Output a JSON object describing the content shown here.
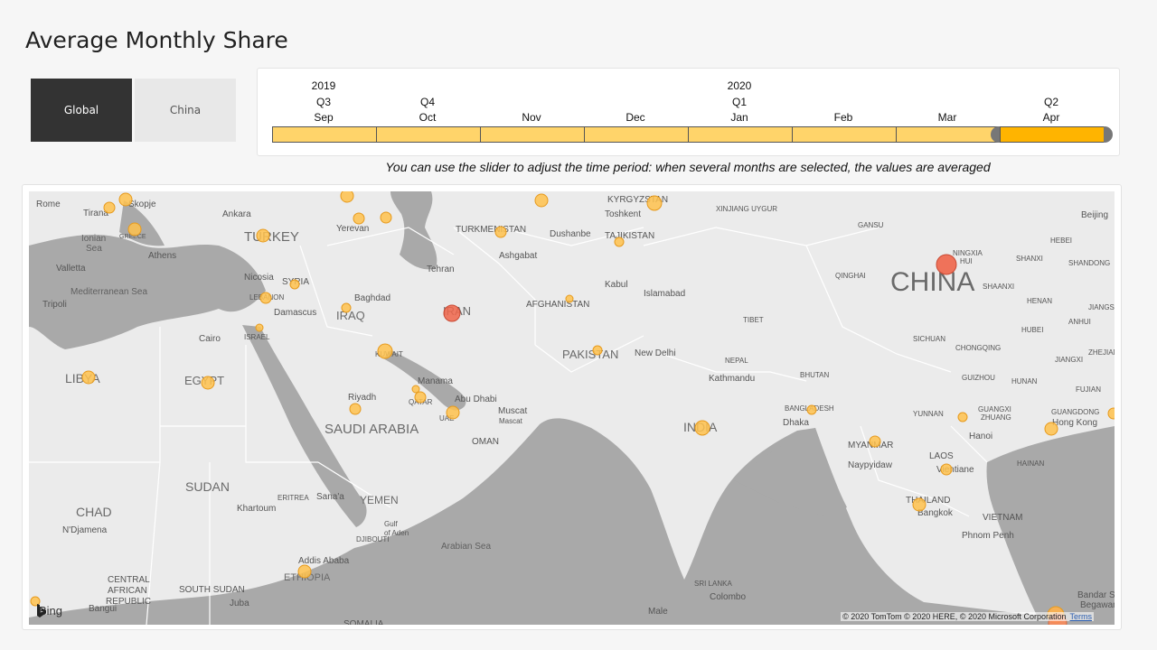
{
  "page": {
    "title": "Average Monthly Share"
  },
  "toggle": {
    "global_label": "Global",
    "china_label": "China",
    "selected": "Global"
  },
  "timeline": {
    "years": [
      "2019",
      "2020"
    ],
    "quarters": [
      "Q3",
      "Q4",
      "Q1",
      "Q2"
    ],
    "months": [
      "Sep",
      "Oct",
      "Nov",
      "Dec",
      "Jan",
      "Feb",
      "Mar",
      "Apr"
    ],
    "selected_month": "Apr",
    "hint": "You can use the slider to adjust the time period: when several months are selected, the values are averaged"
  },
  "map": {
    "attribution_logo": "Bing",
    "copyright": "© 2020 TomTom © 2020 HERE, © 2020 Microsoft Corporation",
    "terms_label": "Terms",
    "colors": {
      "water": "#a8a8a8",
      "land": "#ebebeb",
      "bubble_low": "#ffc24d",
      "bubble_high": "#f0654a"
    },
    "labels": {
      "countries": [
        "TURKEY",
        "SYRIA",
        "LEBANON",
        "ISRAEL",
        "IRAQ",
        "IRAN",
        "KUWAIT",
        "QATAR",
        "UAE",
        "SAUDI ARABIA",
        "OMAN",
        "YEMEN",
        "ERITREA",
        "DJIBOUTI",
        "ETHIOPIA",
        "SUDAN",
        "SOUTH SUDAN",
        "CHAD",
        "CENTRAL AFRICAN REPUBLIC",
        "LIBYA",
        "EGYPT",
        "TURKMENISTAN",
        "KYRGYZSTAN",
        "TAJIKISTAN",
        "AFGHANISTAN",
        "PAKISTAN",
        "INDIA",
        "NEPAL",
        "BHUTAN",
        "BANGLADESH",
        "MYANMAR",
        "LAOS",
        "THAILAND",
        "VIETNAM",
        "CHINA",
        "GREECE",
        "SOMALIA",
        "SRI LANKA"
      ],
      "cities": [
        "Rome",
        "Tirana",
        "Athens",
        "Valletta",
        "Tripoli",
        "Ankara",
        "Yerevan",
        "Nicosia",
        "Damascus",
        "Baghdad",
        "Cairo",
        "Riyadh",
        "Manama",
        "Abu Dhabi",
        "Muscat",
        "Sana'a",
        "Khartoum",
        "N'Djamena",
        "Addis Ababa",
        "Juba",
        "Bangui",
        "Tehran",
        "Ashgabat",
        "Dushanbe",
        "Toshkent",
        "Kabul",
        "Islamabad",
        "New Delhi",
        "Kathmandu",
        "Dhaka",
        "Naypyidaw",
        "Vientiane",
        "Bangkok",
        "Hanoi",
        "Hong Kong",
        "Phnom Penh",
        "Colombo",
        "Male",
        "Beijing",
        "Bandar Seri Begawan"
      ],
      "regions": [
        "Ionian Sea",
        "Mediterranean Sea",
        "Arabian Sea",
        "Gulf of Aden",
        "Skopje",
        "XINJIANG UYGUR",
        "GANSU",
        "QINGHAI",
        "NINGXIA HUI",
        "SHAANXI",
        "SHANXI",
        "HEBEI",
        "SHANDONG",
        "HENAN",
        "ANHUI",
        "JIANGSU",
        "SICHUAN",
        "HUBEI",
        "CHONGQING",
        "ZHEJIANG",
        "JIANGXI",
        "GUIZHOU",
        "HUNAN",
        "FUJIAN",
        "YUNNAN",
        "GUANGXI ZHUANG",
        "GUANGDONG",
        "HAINAN",
        "TIBET"
      ]
    }
  }
}
